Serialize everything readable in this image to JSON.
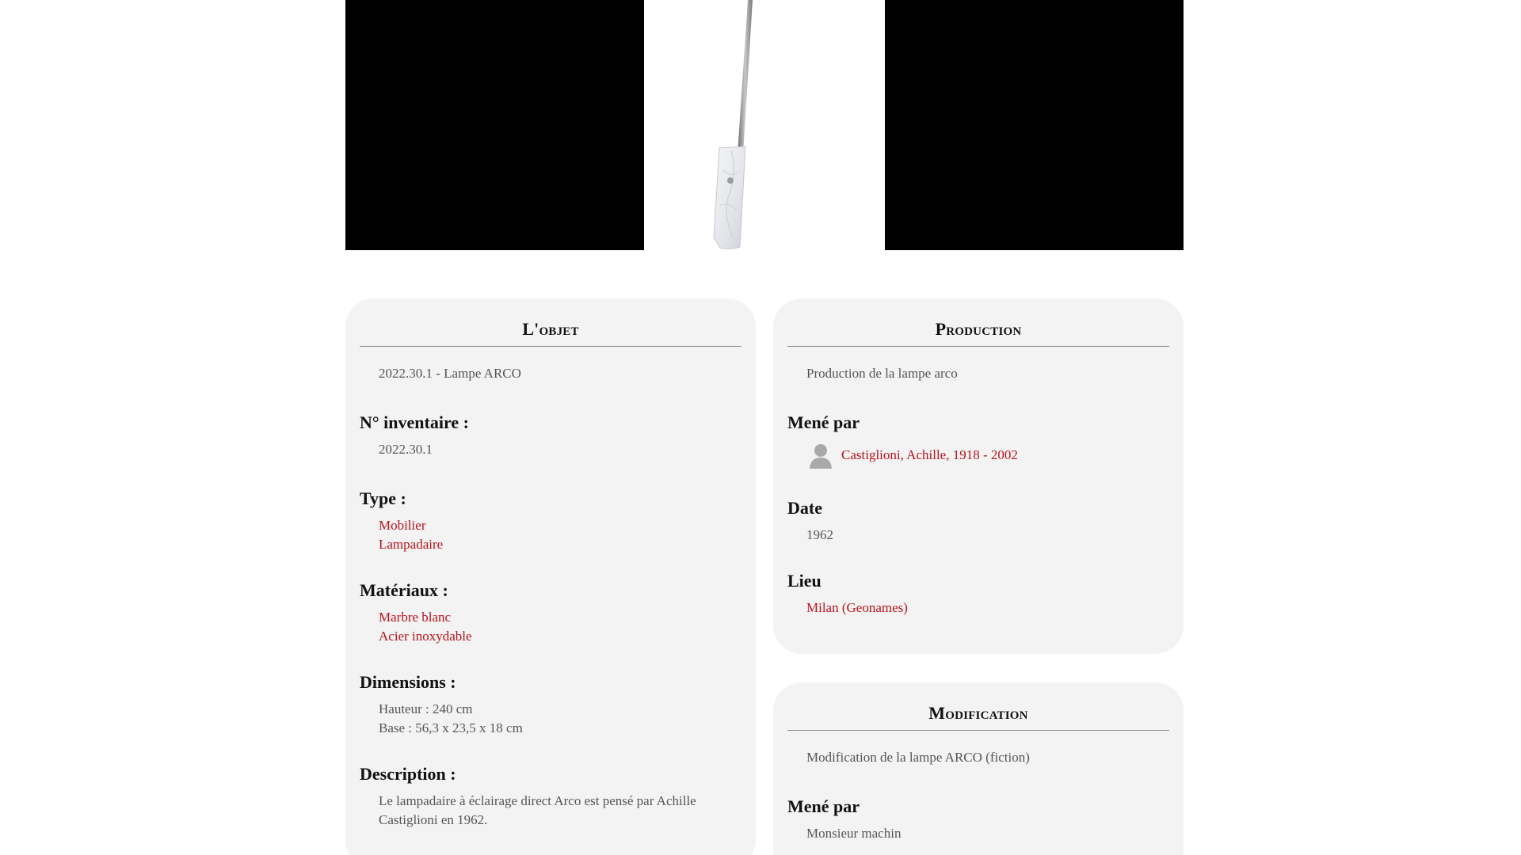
{
  "viewer": {
    "image_alt": "Lampe ARCO"
  },
  "objet": {
    "title": "L'objet",
    "subtitle": "2022.30.1 - Lampe ARCO",
    "inventaire_label": "N° inventaire :",
    "inventaire_value": "2022.30.1",
    "type_label": "Type :",
    "types": [
      "Mobilier",
      "Lampadaire"
    ],
    "materiaux_label": "Matériaux :",
    "materiaux": [
      "Marbre blanc",
      "Acier inoxydable"
    ],
    "dimensions_label": "Dimensions :",
    "dimensions": [
      "Hauteur : 240 cm",
      "Base : 56,3 x 23,5 x 18 cm"
    ],
    "description_label": "Description :",
    "description": "Le lampadaire à éclairage direct Arco est pensé par Achille Castiglioni en 1962."
  },
  "production": {
    "title": "Production",
    "subtitle": "Production de la lampe arco",
    "mene_par_label": "Mené par",
    "person": "Castiglioni, Achille, 1918 - 2002",
    "date_label": "Date",
    "date_value": "1962",
    "lieu_label": "Lieu",
    "lieu_value": "Milan (Geonames)"
  },
  "modification": {
    "title": "Modification",
    "subtitle": "Modification de la lampe ARCO (fiction)",
    "mene_par_label": "Mené par",
    "person": "Monsieur machin"
  },
  "colors": {
    "link": "#b5141c",
    "card_bg": "#f3f3f3",
    "text_muted": "#555555"
  }
}
